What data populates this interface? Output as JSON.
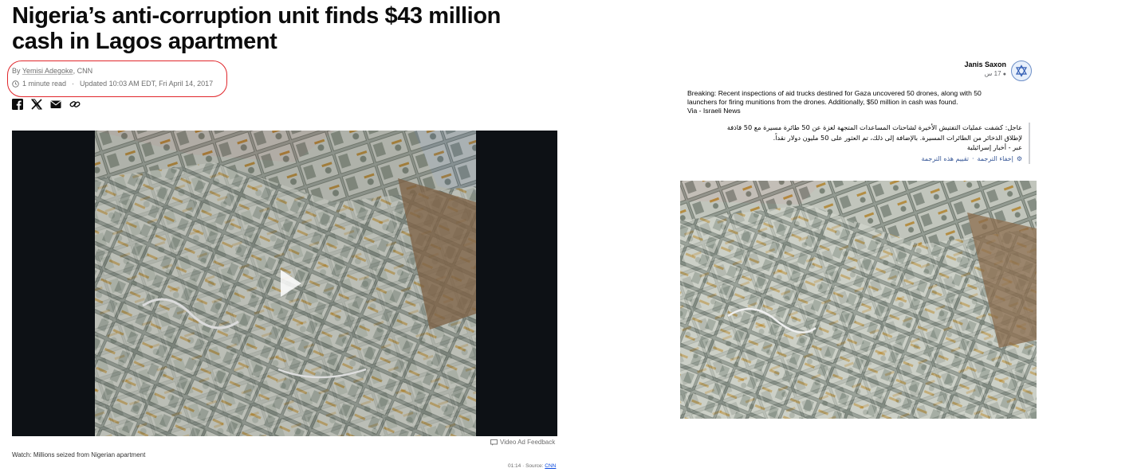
{
  "article": {
    "headline": "Nigeria’s anti-corruption unit finds $43 million cash in Lagos apartment",
    "byline_prefix": "By ",
    "author": "Yemisi Adegoke",
    "outlet": ", CNN",
    "read_time": "1 minute read",
    "updated": "Updated 10:03 AM EDT, Fri April 14, 2017",
    "share_icons": [
      "facebook-icon",
      "x-icon",
      "email-icon",
      "link-icon"
    ],
    "video_ad_feedback": "Video Ad Feedback",
    "caption": "Watch: Millions seized from Nigerian apartment",
    "duration": "01:14",
    "source_label": "Source:",
    "source_link": "CNN",
    "colors": {
      "highlight_oval": "#e0262b",
      "link": "#0c4be0"
    }
  },
  "post": {
    "author": "Janis Saxon",
    "time": "17 س",
    "text_lines": [
      "Breaking: Recent inspections of aid trucks destined for Gaza uncovered 50 drones, along with 50",
      "launchers for firing munitions from the drones. Additionally, $50 million in cash was found.",
      "Via - Israeli News"
    ],
    "translation_lines": [
      "عاجل: كشفت عمليات التفتيش الأخيرة لشاحنات المساعدات المتجهة لغزة عن 50 طائرة مسيرة مع 50 قاذفة",
      "لإطلاق الذخائر من الطائرات المسيرة. بالإضافة إلى ذلك، تم العثور على 50 مليون دولار نقداً.",
      "عبر - أخبار إسرائيلية"
    ],
    "hide_translation": "إخفاء الترجمة",
    "rate_translation": "تقييم هذه الترجمة",
    "separator": "·",
    "colors": {
      "link": "#385898",
      "avatar_border": "#6d8fc7"
    }
  }
}
